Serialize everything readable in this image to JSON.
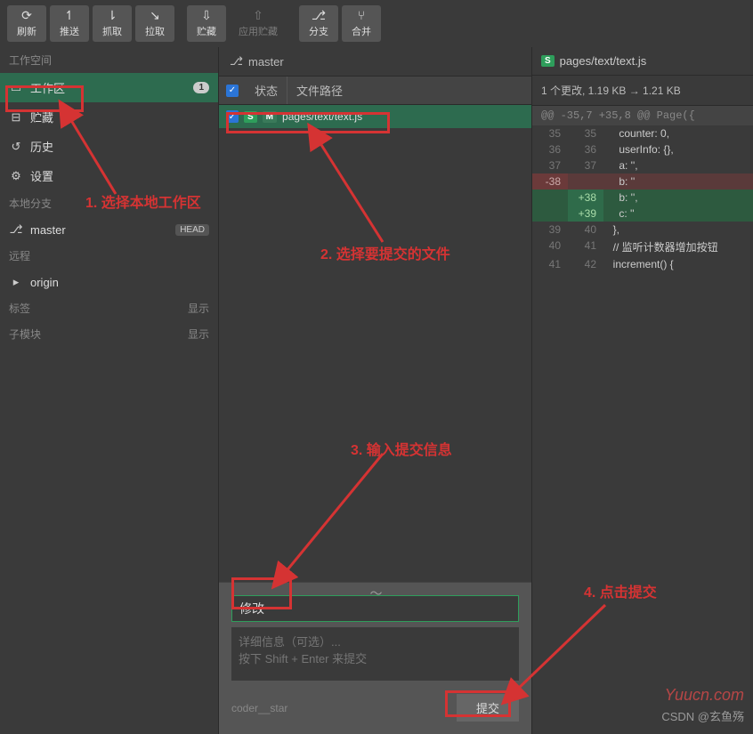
{
  "toolbar": {
    "refresh": "刷新",
    "push": "推送",
    "fetch": "抓取",
    "pull": "拉取",
    "stash": "贮藏",
    "apply_stash": "应用贮藏",
    "branch": "分支",
    "merge": "合并"
  },
  "sidebar": {
    "workspace_hdr": "工作空间",
    "workspace": "工作区",
    "workspace_count": "1",
    "stash": "贮藏",
    "history": "历史",
    "settings": "设置",
    "local_branch_hdr": "本地分支",
    "branch": "master",
    "head_badge": "HEAD",
    "remote_hdr": "远程",
    "origin": "origin",
    "tags_hdr": "标签",
    "submodule_hdr": "子模块",
    "show": "显示"
  },
  "center": {
    "branch": "master",
    "col_status": "状态",
    "col_path": "文件路径",
    "file_badge_s": "S",
    "file_badge_m": "M",
    "file_path": "pages/text/text.js",
    "commit_summary": "修改",
    "commit_detail_placeholder": "详细信息（可选）...\n按下 Shift + Enter 来提交",
    "commit_user": "coder__star",
    "commit_btn": "提交"
  },
  "diff": {
    "file": "pages/text/text.js",
    "meta": "1 个更改, 1.19 KB → 1.21 KB",
    "hunk": "@@ -35,7 +35,8 @@ Page({",
    "lines": [
      {
        "l": "35",
        "r": "35",
        "t": "    counter: 0,",
        "c": ""
      },
      {
        "l": "36",
        "r": "36",
        "t": "    userInfo: {},",
        "c": ""
      },
      {
        "l": "37",
        "r": "37",
        "t": "    a: '',",
        "c": ""
      },
      {
        "l": "-38",
        "r": "",
        "t": "    b: ''",
        "c": "del"
      },
      {
        "l": "",
        "r": "+38",
        "t": "    b: '',",
        "c": "add"
      },
      {
        "l": "",
        "r": "+39",
        "t": "    c: ''",
        "c": "add"
      },
      {
        "l": "39",
        "r": "40",
        "t": "  },",
        "c": ""
      },
      {
        "l": "40",
        "r": "41",
        "t": "  // 监听计数器增加按钮",
        "c": ""
      },
      {
        "l": "41",
        "r": "42",
        "t": "  increment() {",
        "c": ""
      }
    ]
  },
  "anno": {
    "a1": "1. 选择本地工作区",
    "a2": "2. 选择要提交的文件",
    "a3": "3. 输入提交信息",
    "a4": "4. 点击提交"
  },
  "watermark": "Yuucn.com",
  "credit": "CSDN @玄鱼殇"
}
